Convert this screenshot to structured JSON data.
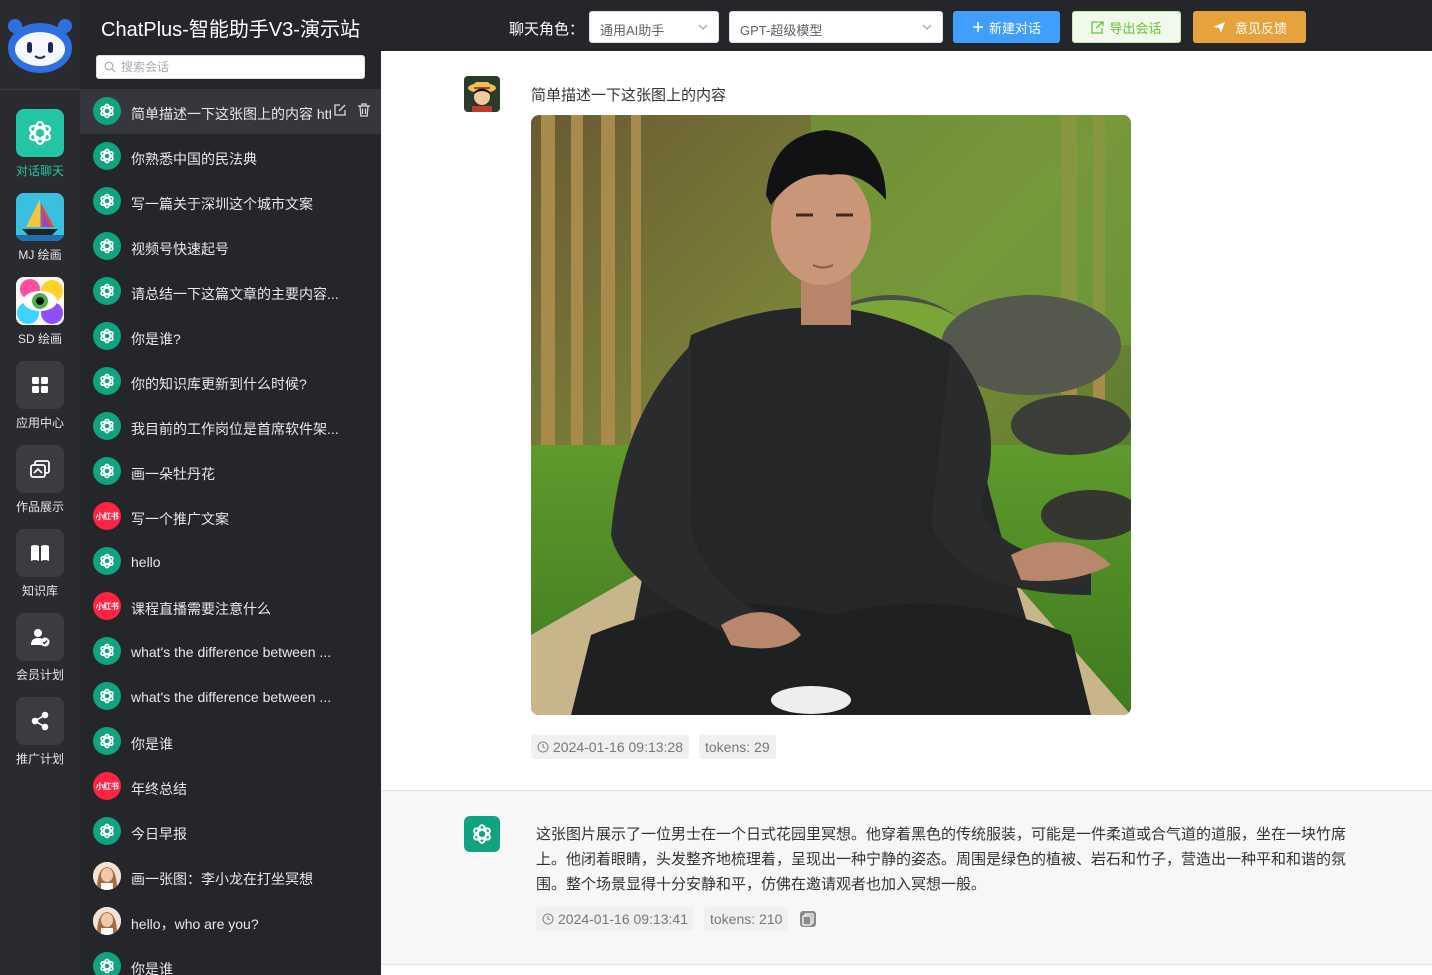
{
  "app": {
    "title": "ChatPlus-智能助手V3-演示站"
  },
  "nav": {
    "items": [
      {
        "label": "对话聊天",
        "icon": "openai-icon",
        "active": true
      },
      {
        "label": "MJ 绘画",
        "icon": "mj-boat-icon"
      },
      {
        "label": "SD 绘画",
        "icon": "sd-eye-icon"
      },
      {
        "label": "应用中心",
        "icon": "grid-icon"
      },
      {
        "label": "作品展示",
        "icon": "gallery-icon"
      },
      {
        "label": "知识库",
        "icon": "book-icon"
      },
      {
        "label": "会员计划",
        "icon": "member-icon"
      },
      {
        "label": "推广计划",
        "icon": "share-icon"
      }
    ]
  },
  "sidebar": {
    "search_placeholder": "搜索会话",
    "conversations": [
      {
        "title": "简单描述一下这张图上的内容 htt",
        "avatar": "gpt"
      },
      {
        "title": "你熟悉中国的民法典",
        "avatar": "gpt"
      },
      {
        "title": "写一篇关于深圳这个城市文案",
        "avatar": "gpt"
      },
      {
        "title": "视频号快速起号",
        "avatar": "gpt"
      },
      {
        "title": "请总结一下这篇文章的主要内容...",
        "avatar": "gpt"
      },
      {
        "title": "你是谁?",
        "avatar": "gpt"
      },
      {
        "title": "你的知识库更新到什么时候?",
        "avatar": "gpt"
      },
      {
        "title": "我目前的工作岗位是首席软件架...",
        "avatar": "gpt"
      },
      {
        "title": "画一朵牡丹花",
        "avatar": "gpt"
      },
      {
        "title": "写一个推广文案",
        "avatar": "red"
      },
      {
        "title": "hello",
        "avatar": "gpt"
      },
      {
        "title": "课程直播需要注意什么",
        "avatar": "red"
      },
      {
        "title": "what's the difference between ...",
        "avatar": "gpt"
      },
      {
        "title": "what's the difference between ...",
        "avatar": "gpt"
      },
      {
        "title": "你是谁",
        "avatar": "gpt"
      },
      {
        "title": "年终总结",
        "avatar": "red"
      },
      {
        "title": "今日早报",
        "avatar": "gpt"
      },
      {
        "title": "画一张图：李小龙在打坐冥想",
        "avatar": "lady"
      },
      {
        "title": "hello，who are you?",
        "avatar": "lady"
      },
      {
        "title": "你是谁",
        "avatar": "gpt"
      }
    ],
    "red_avatar_text": "小红书"
  },
  "topbar": {
    "role_label": "聊天角色：",
    "role_value": "通用AI助手",
    "model_value": "GPT-超级模型",
    "new_chat": "新建对话",
    "export_chat": "导出会话",
    "feedback": "意见反馈"
  },
  "chat": {
    "user_message": "简单描述一下这张图上的内容",
    "user_time": "2024-01-16 09:13:28",
    "user_tokens": "tokens: 29",
    "bot_message": "这张图片展示了一位男士在一个日式花园里冥想。他穿着黑色的传统服装，可能是一件柔道或合气道的道服，坐在一块竹席上。他闭着眼睛，头发整齐地梳理着，呈现出一种宁静的姿态。周围是绿色的植被、岩石和竹子，营造出一种平和和谐的氛围。整个场景显得十分安静和平，仿佛在邀请观者也加入冥想一般。",
    "bot_time": "2024-01-16 09:13:41",
    "bot_tokens": "tokens: 210"
  },
  "colors": {
    "accent_green": "#22c6a4",
    "primary_blue": "#409eff",
    "export_green": "#67c23a",
    "warning_orange": "#e6a23c"
  }
}
